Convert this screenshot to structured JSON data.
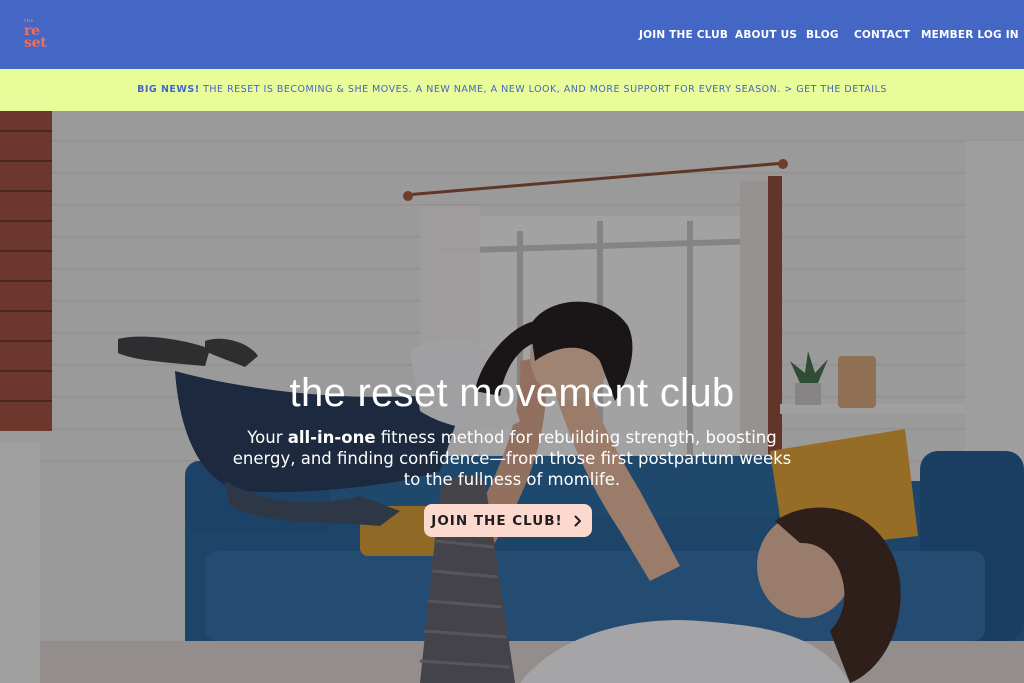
{
  "header": {
    "logo": {
      "line1": "the",
      "line2": "re",
      "line3": "set"
    },
    "nav": [
      {
        "label": "JOIN THE CLUB"
      },
      {
        "label": "ABOUT US"
      },
      {
        "label": "BLOG"
      },
      {
        "label": "CONTACT"
      },
      {
        "label": "MEMBER LOG IN"
      }
    ]
  },
  "announcement": {
    "bold": "BIG NEWS!",
    "text": "THE RESET IS BECOMING & SHE MOVES. A NEW NAME, A NEW LOOK, AND MORE SUPPORT FOR EVERY SEASON.",
    "link": "> GET THE DETAILS"
  },
  "hero": {
    "title": "the reset movement club",
    "subtitle_before": "Your ",
    "subtitle_bold": "all-in-one",
    "subtitle_after": " fitness method for rebuilding strength, boosting energy, and finding confidence—from those first postpartum weeks to the fullness of momlife.",
    "cta_label": "JOIN THE CLUB!",
    "cta_icon": "chevron-right-icon"
  },
  "colors": {
    "header_bg": "#4466c4",
    "logo": "#ef6f5b",
    "announcement_bg": "#e8fc99",
    "announcement_text": "#4466c4",
    "cta_bg": "#fcd9cf"
  }
}
